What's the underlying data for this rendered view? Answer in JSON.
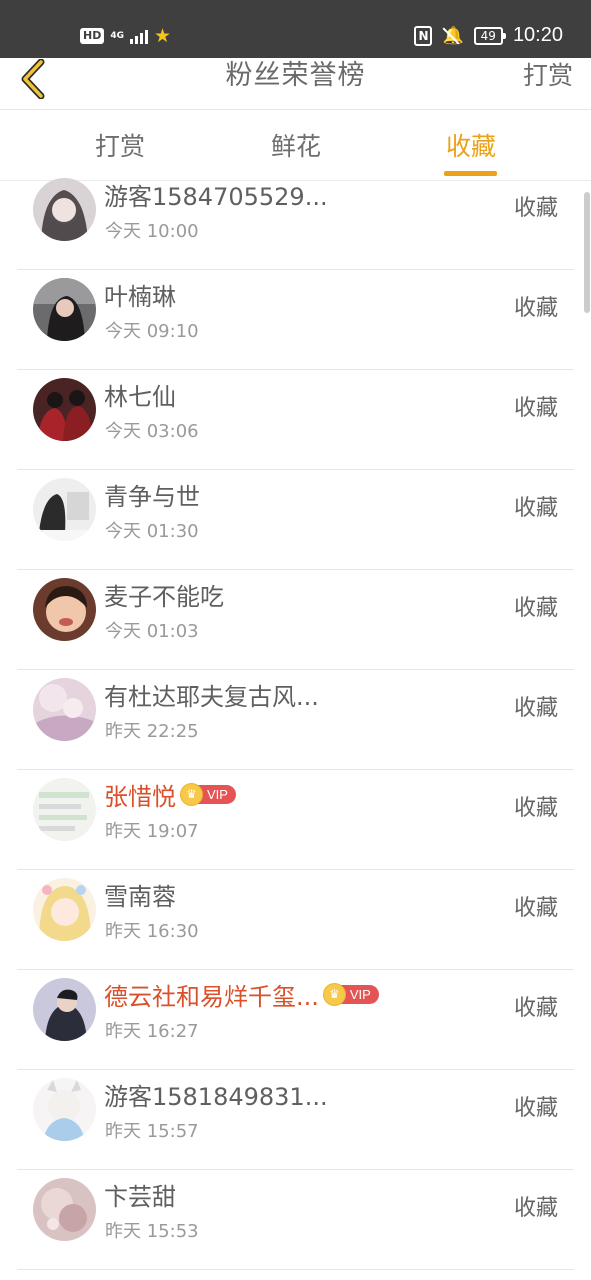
{
  "status_bar": {
    "hd": "HD",
    "network": "4G",
    "battery": "49",
    "time": "10:20"
  },
  "header": {
    "title": "粉丝荣誉榜",
    "action": "打赏"
  },
  "tabs": [
    {
      "label": "打赏",
      "active": false
    },
    {
      "label": "鲜花",
      "active": false
    },
    {
      "label": "收藏",
      "active": true
    }
  ],
  "colors": {
    "accent": "#eba21a",
    "vip_name": "#d9502b",
    "vip_badge": "#e55454"
  },
  "fans": [
    {
      "name": "游客1584705529...",
      "time": "今天 10:00",
      "action": "收藏",
      "vip": false
    },
    {
      "name": "叶楠琳",
      "time": "今天 09:10",
      "action": "收藏",
      "vip": false
    },
    {
      "name": "林七仙",
      "time": "今天 03:06",
      "action": "收藏",
      "vip": false
    },
    {
      "name": "青争与世",
      "time": "今天 01:30",
      "action": "收藏",
      "vip": false
    },
    {
      "name": "麦子不能吃",
      "time": "今天 01:03",
      "action": "收藏",
      "vip": false
    },
    {
      "name": "有杜达耶夫复古风...",
      "time": "昨天 22:25",
      "action": "收藏",
      "vip": false
    },
    {
      "name": "张惜悦",
      "time": "昨天 19:07",
      "action": "收藏",
      "vip": true,
      "badge": "VIP"
    },
    {
      "name": "雪南蓉",
      "time": "昨天 16:30",
      "action": "收藏",
      "vip": false
    },
    {
      "name": "德云社和易烊千玺...",
      "time": "昨天 16:27",
      "action": "收藏",
      "vip": true,
      "badge": "VIP"
    },
    {
      "name": "游客1581849831...",
      "time": "昨天 15:57",
      "action": "收藏",
      "vip": false
    },
    {
      "name": "卞芸甜",
      "time": "昨天 15:53",
      "action": "收藏",
      "vip": false
    }
  ]
}
